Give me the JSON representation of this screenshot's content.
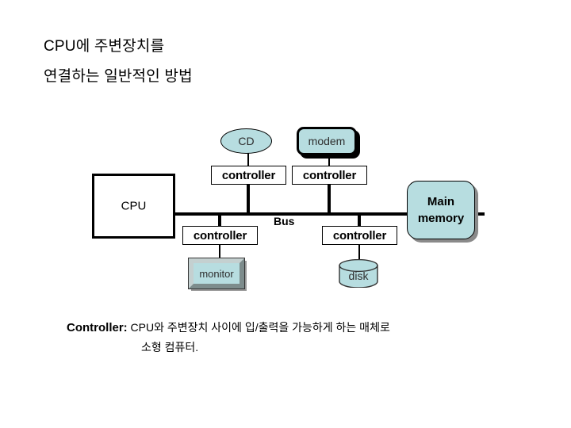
{
  "slide": {
    "title_lines": [
      "CPU에 주변장치를",
      "연결하는 일반적인 방법"
    ]
  },
  "diagram": {
    "cpu": {
      "label": "CPU"
    },
    "bus": {
      "label": "Bus"
    },
    "controllers": [
      {
        "id": "controller-cd",
        "label": "controller"
      },
      {
        "id": "controller-modem",
        "label": "controller"
      },
      {
        "id": "controller-monitor",
        "label": "controller"
      },
      {
        "id": "controller-disk",
        "label": "controller"
      }
    ],
    "devices": [
      {
        "id": "cd",
        "label": "CD",
        "shape": "ellipse"
      },
      {
        "id": "modem",
        "label": "modem",
        "shape": "rounded-rect-shadow"
      },
      {
        "id": "monitor",
        "label": "monitor",
        "shape": "beveled-frame"
      },
      {
        "id": "disk",
        "label": "disk",
        "shape": "cylinder"
      }
    ],
    "memory": {
      "line1": "Main",
      "line2": "memory",
      "shape": "rounded-rect"
    }
  },
  "caption": {
    "term": "Controller:",
    "line1": " CPU와 주변장치 사이에 입/출력을 가능하게 하는 매체로",
    "line2": "소형 컴퓨터."
  },
  "colors": {
    "device_fill": "#b7dde0",
    "bevel_light": "#c4d0d0",
    "bevel_dark": "#7d8c8c",
    "shadow": "#8a8a8a",
    "stroke": "#000000",
    "background": "#ffffff"
  }
}
